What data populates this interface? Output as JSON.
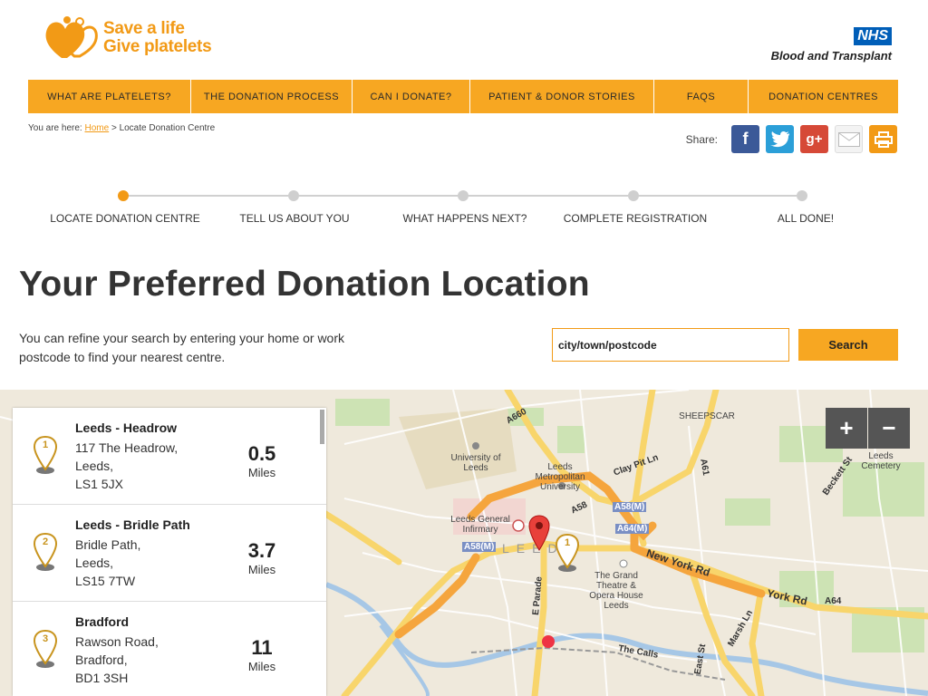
{
  "header": {
    "logo_line1": "Save a life",
    "logo_line2": "Give platelets",
    "nhs_badge": "NHS",
    "nhs_subtitle": "Blood and Transplant"
  },
  "nav": [
    {
      "label": "WHAT ARE PLATELETS?"
    },
    {
      "label": "THE DONATION PROCESS"
    },
    {
      "label": "CAN I DONATE?"
    },
    {
      "label": "PATIENT & DONOR STORIES"
    },
    {
      "label": "FAQS"
    },
    {
      "label": "DONATION CENTRES"
    }
  ],
  "breadcrumb": {
    "prefix": "You are here:",
    "home": "Home",
    "separator": ">",
    "current": "Locate Donation Centre"
  },
  "share": {
    "label": "Share:",
    "icons": [
      "facebook-icon",
      "twitter-icon",
      "google-plus-icon",
      "email-icon",
      "print-icon"
    ]
  },
  "steps": [
    {
      "label": "LOCATE DONATION CENTRE",
      "active": true
    },
    {
      "label": "TELL US ABOUT YOU",
      "active": false
    },
    {
      "label": "WHAT HAPPENS NEXT?",
      "active": false
    },
    {
      "label": "COMPLETE REGISTRATION",
      "active": false
    },
    {
      "label": "ALL DONE!",
      "active": false
    }
  ],
  "main": {
    "title": "Your Preferred Donation Location",
    "intro": "You can refine your search by entering your home or work postcode to find your nearest centre.",
    "search_placeholder": "city/town/postcode",
    "search_button": "Search"
  },
  "map": {
    "zoom_in": "+",
    "zoom_out": "−",
    "labels": {
      "university": "University of Leeds",
      "met": "Leeds Metropolitan University",
      "lgi": "Leeds General Infirmary",
      "leeds": "LEEDS",
      "grand": "The Grand Theatre & Opera House Leeds",
      "sheepscar": "SHEEPSCAR",
      "cemetery": "Leeds Cemetery",
      "a660": "A660",
      "a58": "A58",
      "a61": "A61",
      "a58m": "A58(M)",
      "a64m": "A64(M)",
      "a64": "A64",
      "new_york_rd": "New York Rd",
      "york_rd": "York Rd",
      "clay_pit": "Clay Pit Ln",
      "marsh_ln": "Marsh Ln",
      "e_parade": "E Parade",
      "the_calls": "The Calls",
      "east_st": "East St",
      "beckett": "Beckett St"
    },
    "marker_number": "1"
  },
  "results": [
    {
      "number": "1",
      "name": "Leeds - Headrow",
      "address": [
        "117 The Headrow,",
        "Leeds,",
        "LS1 5JX"
      ],
      "distance": "0.5",
      "unit": "Miles"
    },
    {
      "number": "2",
      "name": "Leeds - Bridle Path",
      "address": [
        "Bridle Path,",
        "Leeds,",
        "LS15 7TW"
      ],
      "distance": "3.7",
      "unit": "Miles"
    },
    {
      "number": "3",
      "name": "Bradford",
      "address": [
        "Rawson Road,",
        "Bradford,",
        "BD1 3SH"
      ],
      "distance": "11",
      "unit": "Miles"
    }
  ],
  "colors": {
    "accent": "#f7a722",
    "accent_dark": "#f29a16",
    "nhs_blue": "#005eb8"
  }
}
